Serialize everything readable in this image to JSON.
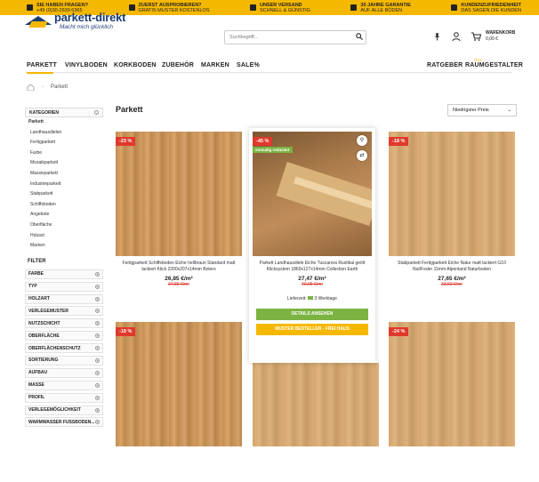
{
  "topbar": [
    {
      "icon": "phone-icon",
      "line1": "SIE HABEN FRAGEN?",
      "line2": "+49 (0)30-2639 6365"
    },
    {
      "icon": "truck-icon",
      "line1": "ZUERST AUSPROBIEREN?",
      "line2": "GRATIS MUSTER KOSTENLOS"
    },
    {
      "icon": "delivery-icon",
      "line1": "UNSER VERSAND",
      "line2": "SCHNELL & GÜNSTIG"
    },
    {
      "icon": "shield-icon",
      "line1": "30 JAHRE GARANTIE",
      "line2": "AUF ALLE BÖDEN"
    },
    {
      "icon": "smile-icon",
      "line1": "KUNDENZUFRIEDENHEIT",
      "line2": "DAS SAGEN DIE KUNDEN"
    }
  ],
  "logo": {
    "name": "parkett-direkt",
    "tagline": "Macht mich glücklich"
  },
  "search": {
    "placeholder": "Suchbegriff..."
  },
  "cart": {
    "label": "WARENKORB",
    "amount": "0,00 €"
  },
  "nav": {
    "items": [
      "PARKETT",
      "VINYLBODEN",
      "KORKBODEN",
      "ZUBEHÖR",
      "MARKEN",
      "SALE%"
    ],
    "right": [
      "RATGEBER",
      "RAUMGESTALTER"
    ],
    "right_note": "Neu"
  },
  "breadcrumb": {
    "current": "Parkett"
  },
  "sidebar": {
    "categories_title": "KATEGORIEN",
    "top": "Parkett",
    "items": [
      "Landhausdielen",
      "Fertigparkett",
      "Farbe",
      "Mosaikparkett",
      "Massivparkett",
      "Industrieparkett",
      "Stabparkett",
      "Schiffsboden",
      "Angebote",
      "Oberfläche",
      "Holzart",
      "Marken"
    ],
    "filter_title": "FILTER",
    "filters": [
      "FARBE",
      "TYP",
      "HOLZART",
      "VERLEGEMUSTER",
      "NUTZSCHICHT",
      "OBERFLÄCHE",
      "OBERFLÄCHENSCHUTZ",
      "SORTIERUNG",
      "AUFBAU",
      "MASSE",
      "PROFIL",
      "VERLEGEMÖGLICHKEIT",
      "WARMWASSER FUSSBODEN..."
    ]
  },
  "main": {
    "title": "Parkett",
    "sort": "Niedrigster Preis"
  },
  "products": [
    {
      "badge": "-23 %",
      "name": "Fertigparkett Schiffsboden Eiche hellbraun Standard matt lackiert Klick 2200x207x14mm Bolero",
      "price": "26,85 €/m²",
      "old": "34,85 €/m²"
    },
    {
      "badge": "-45 %",
      "tag": "einmalig reduziert",
      "name": "Parkett Landhausdiele Eiche Tuscarora Rustikal geölt Klicksystem 1860x127x14mm Collection Earth",
      "price": "27,47 €/m²",
      "old": "49,95 €/m²",
      "delivery": "Lieferzeit:",
      "delivery_val": "3 Werktage",
      "btn1": "DETAILS ANSEHEN",
      "btn2": "MUSTER BESTELLEN - FREI HAUS"
    },
    {
      "badge": "-18 %",
      "name": "Stabparkett Fertigparkett Eiche Natur matt lackiert G10 Nut/Feder 11mm Alpenland Naturboden",
      "price": "27,65 €/m²",
      "old": "33,60 €/m²"
    },
    {
      "badge": "-18 %"
    },
    {
      "badge": ""
    },
    {
      "badge": "-24 %"
    }
  ]
}
